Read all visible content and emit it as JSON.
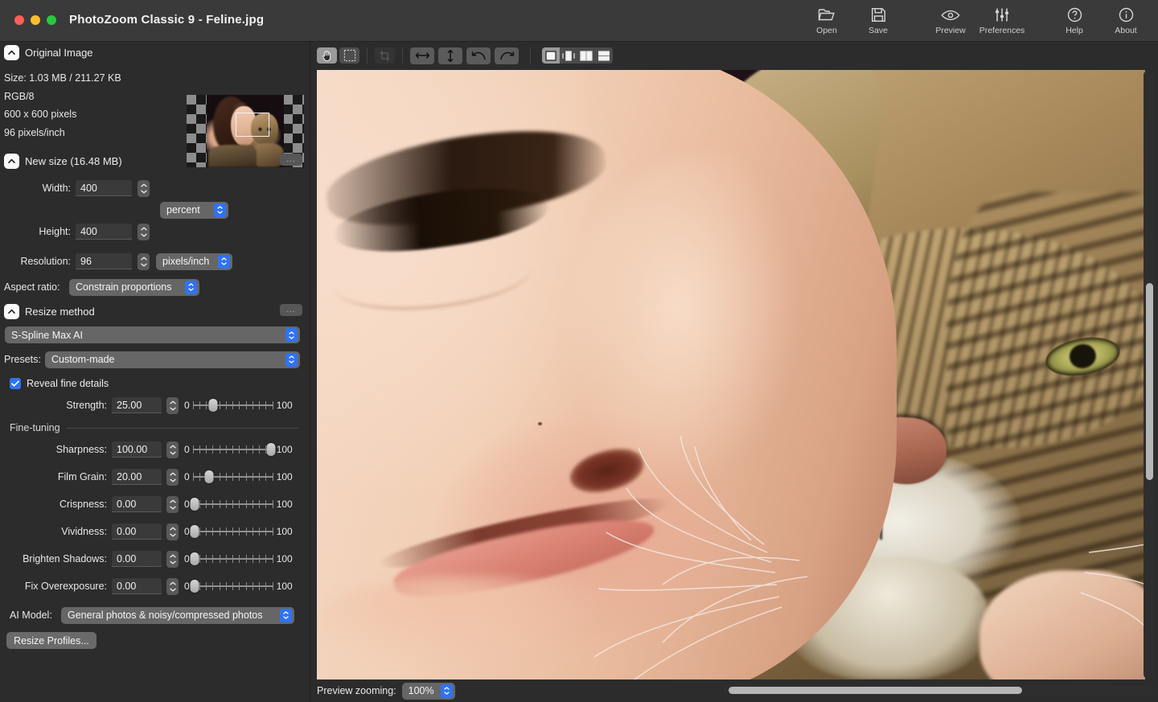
{
  "window": {
    "title": "PhotoZoom Classic 9  -  Feline.jpg",
    "traffic": {
      "close": "close-button",
      "minimize": "minimize-button",
      "zoom": "zoom-button"
    }
  },
  "toolbar": {
    "items": [
      {
        "label": "Open",
        "icon": "folder-open-icon"
      },
      {
        "label": "Save",
        "icon": "floppy-disk-icon"
      },
      {
        "label": "Preview",
        "icon": "eye-icon"
      },
      {
        "label": "Preferences",
        "icon": "sliders-icon"
      },
      {
        "label": "Help",
        "icon": "question-circle-icon"
      },
      {
        "label": "About",
        "icon": "info-circle-icon"
      }
    ]
  },
  "original_image": {
    "section_title": "Original Image",
    "size": "Size: 1.03 MB / 211.27 KB",
    "color_mode": "RGB/8",
    "dimensions": "600 x 600 pixels",
    "resolution": "96 pixels/inch"
  },
  "new_size": {
    "section_title": "New size (16.48 MB)",
    "options_label": "...",
    "width_label": "Width:",
    "width_value": "400",
    "width_unit": "percent",
    "height_label": "Height:",
    "height_value": "400",
    "resolution_label": "Resolution:",
    "resolution_value": "96",
    "resolution_unit": "pixels/inch",
    "aspect_label": "Aspect ratio:",
    "aspect_value": "Constrain proportions"
  },
  "resize_method": {
    "section_title": "Resize method",
    "options_label": "...",
    "method": "S-Spline Max AI",
    "presets_label": "Presets:",
    "presets_value": "Custom-made",
    "reveal_label": "Reveal fine details",
    "reveal_checked": true,
    "finetuning_label": "Fine-tuning",
    "sliders": [
      {
        "label": "Strength:",
        "value": "25.00",
        "min": "0",
        "max": "100",
        "percent": 25
      },
      {
        "label": "Sharpness:",
        "value": "100.00",
        "min": "0",
        "max": "100",
        "percent": 100
      },
      {
        "label": "Film Grain:",
        "value": "20.00",
        "min": "0",
        "max": "100",
        "percent": 20
      },
      {
        "label": "Crispness:",
        "value": "0.00",
        "min": "0",
        "max": "100",
        "percent": 0
      },
      {
        "label": "Vividness:",
        "value": "0.00",
        "min": "0",
        "max": "100",
        "percent": 0
      },
      {
        "label": "Brighten Shadows:",
        "value": "0.00",
        "min": "0",
        "max": "100",
        "percent": 0
      },
      {
        "label": "Fix Overexposure:",
        "value": "0.00",
        "min": "0",
        "max": "100",
        "percent": 0
      }
    ],
    "ai_model_label": "AI Model:",
    "ai_model_value": "General photos & noisy/compressed photos",
    "resize_profiles_button": "Resize Profiles..."
  },
  "preview_toolbar": {
    "tools": [
      {
        "name": "hand-tool",
        "active": true
      },
      {
        "name": "marquee-select-tool",
        "active": false
      },
      {
        "name": "crop-tool",
        "active": false,
        "disabled": true
      }
    ],
    "fit_buttons": [
      {
        "name": "fit-width-icon"
      },
      {
        "name": "fit-height-icon"
      },
      {
        "name": "rotate-left-icon"
      },
      {
        "name": "rotate-right-icon"
      }
    ],
    "view_modes": [
      {
        "name": "view-single",
        "active": true
      },
      {
        "name": "view-split-center",
        "active": false
      },
      {
        "name": "view-side-by-side",
        "active": false
      },
      {
        "name": "view-stacked",
        "active": false
      }
    ]
  },
  "status": {
    "preview_zoom_label": "Preview zooming:",
    "preview_zoom_value": "100%"
  },
  "colors": {
    "accent_blue": "#2f73f4",
    "panel_bg": "#2c2c2c",
    "titlebar_bg": "#3a3a3a",
    "text": "#ededed"
  }
}
